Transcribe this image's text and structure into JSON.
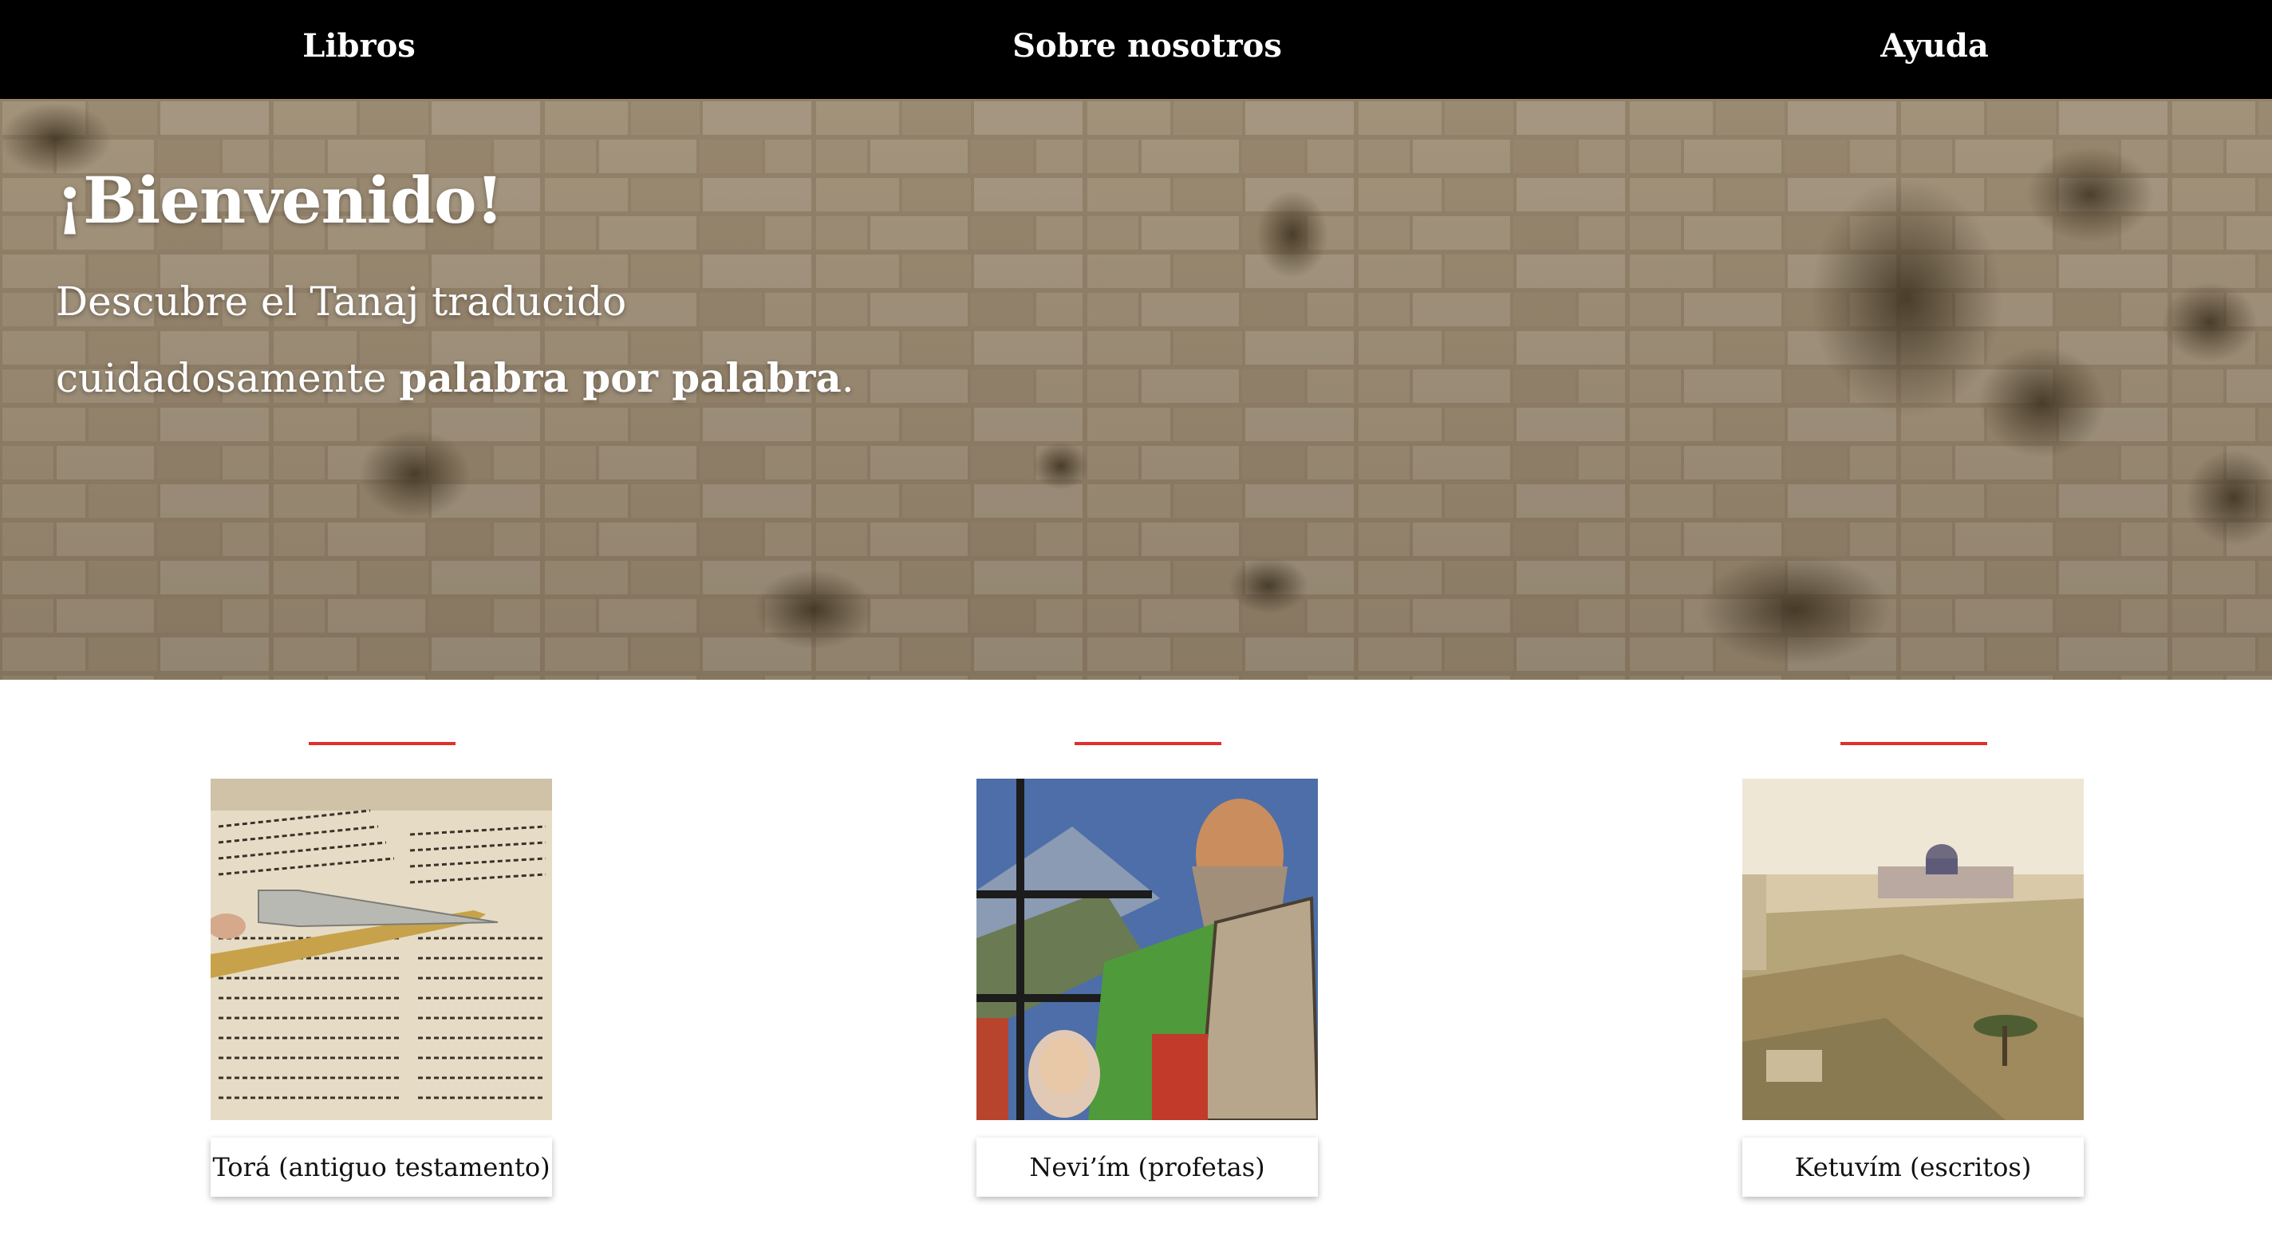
{
  "nav": {
    "items": [
      {
        "label": "Libros"
      },
      {
        "label": "Sobre nosotros"
      },
      {
        "label": "Ayuda"
      }
    ]
  },
  "hero": {
    "title": "¡Bienvenido!",
    "subtitle_start": "Descubre el Tanaj traducido cuidadosamente ",
    "subtitle_bold": "palabra por palabra",
    "subtitle_end": "."
  },
  "books": [
    {
      "label": "Torá (antiguo testamento)",
      "image": "torah-scroll-with-yad-pointer"
    },
    {
      "label": "Nevi’ím (profetas)",
      "image": "stained-glass-moses-with-tablets"
    },
    {
      "label": "Ketuvím (escritos)",
      "image": "painting-of-jerusalem-landscape"
    }
  ],
  "colors": {
    "nav_bg": "#000000",
    "accent_rule": "#e0302c",
    "hero_text": "#ffffff"
  }
}
